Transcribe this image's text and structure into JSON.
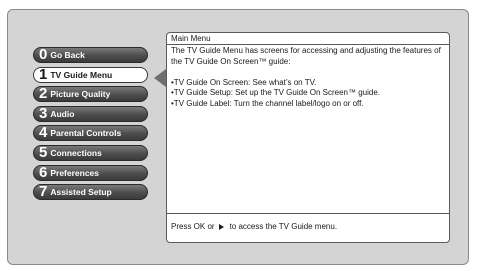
{
  "menu": {
    "items": [
      {
        "num": "0",
        "label": "Go Back",
        "selected": false
      },
      {
        "num": "1",
        "label": "TV Guide Menu",
        "selected": true
      },
      {
        "num": "2",
        "label": "Picture Quality",
        "selected": false
      },
      {
        "num": "3",
        "label": "Audio",
        "selected": false
      },
      {
        "num": "4",
        "label": "Parental Controls",
        "selected": false
      },
      {
        "num": "5",
        "label": "Connections",
        "selected": false
      },
      {
        "num": "6",
        "label": "Preferences",
        "selected": false
      },
      {
        "num": "7",
        "label": "Assisted Setup",
        "selected": false
      }
    ]
  },
  "panel": {
    "title": "Main Menu",
    "intro": "The TV Guide Menu has screens for accessing and adjusting the features of the TV Guide On Screen™ guide:",
    "bullets": [
      "•TV Guide On Screen: See what’s on TV.",
      "•TV Guide Setup: Set up the TV Guide On Screen™ guide.",
      "•TV Guide Label: Turn the channel label/logo on or off."
    ],
    "footer_before": "Press OK or",
    "footer_after": "to access the TV Guide menu."
  }
}
